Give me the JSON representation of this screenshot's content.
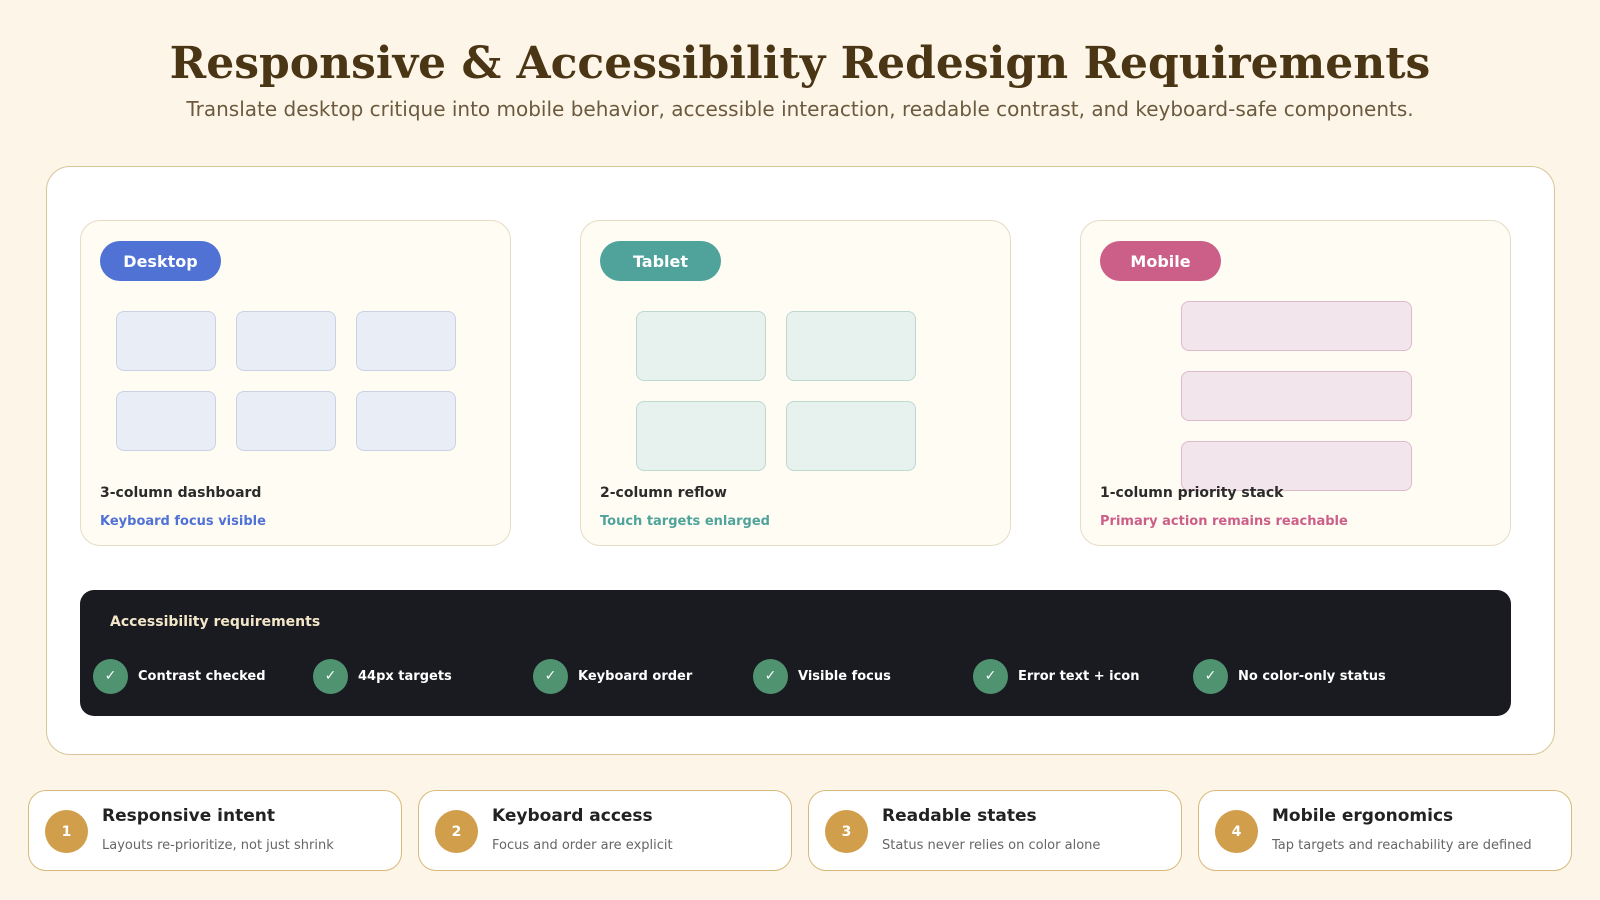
{
  "header": {
    "title": "Responsive & Accessibility Redesign Requirements",
    "subtitle": "Translate desktop critique into mobile behavior, accessible interaction, readable contrast, and keyboard-safe components."
  },
  "colors": {
    "desktop": "#4f72d4",
    "tablet": "#4fa39a",
    "mobile": "#cc5f88",
    "check": "#4f9370",
    "step": "#d19e4b"
  },
  "devices": {
    "desktop": {
      "label": "Desktop",
      "caption": "3-column dashboard",
      "note": "Keyboard focus visible"
    },
    "tablet": {
      "label": "Tablet",
      "caption": "2-column reflow",
      "note": "Touch targets enlarged"
    },
    "mobile": {
      "label": "Mobile",
      "caption": "1-column priority stack",
      "note": "Primary action remains reachable"
    }
  },
  "accessibility": {
    "title": "Accessibility requirements",
    "checkmark": "✓",
    "items": [
      "Contrast checked",
      "44px targets",
      "Keyboard order",
      "Visible focus",
      "Error text + icon",
      "No color-only status"
    ]
  },
  "principles": [
    {
      "num": "1",
      "title": "Responsive intent",
      "desc": "Layouts re-prioritize, not just shrink"
    },
    {
      "num": "2",
      "title": "Keyboard access",
      "desc": "Focus and order are explicit"
    },
    {
      "num": "3",
      "title": "Readable states",
      "desc": "Status never relies on color alone"
    },
    {
      "num": "4",
      "title": "Mobile ergonomics",
      "desc": "Tap targets and reachability are defined"
    }
  ]
}
